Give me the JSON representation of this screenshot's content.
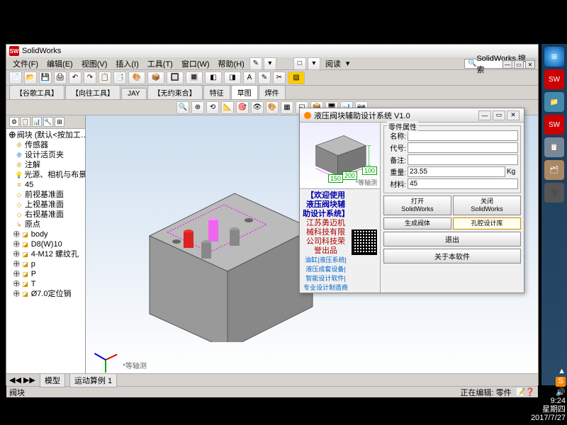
{
  "app": {
    "name": "SolidWorks"
  },
  "menus": [
    "文件(F)",
    "编辑(E)",
    "视图(V)",
    "插入(I)",
    "工具(T)",
    "窗口(W)",
    "帮助(H)"
  ],
  "search": {
    "placeholder": "SolidWorks 搜索"
  },
  "read_label": "阅读",
  "ribbon_tabs": [
    "【谷歌工具】",
    "【向往工具】",
    "JAY",
    "【无约束合】",
    "特征",
    "草图",
    "焊件"
  ],
  "active_tab": "草图",
  "tree": {
    "root": "阀块  (默认<按加工…",
    "items": [
      "传感器",
      "设计活页夹",
      "注解",
      "光源、相机与布景",
      "45",
      "前视基准面",
      "上视基准面",
      "右视基准面",
      "原点",
      "body",
      "D8(W)10",
      "4-M12 螺纹孔",
      "p",
      "P",
      "T",
      "Ø7.0定位销"
    ]
  },
  "iso_label": "*等轴测",
  "bottom_tabs": [
    "模型",
    "运动算例 1"
  ],
  "status": {
    "left": "阀块",
    "right": "正在编辑: 零件"
  },
  "dialog": {
    "title": "液压阀块辅助设计系统 V1.0",
    "props_legend": "零件属性",
    "labels": {
      "name": "名称:",
      "code": "代号:",
      "note": "备注:",
      "weight": "重量:",
      "material": "材料:",
      "kg": "Kg"
    },
    "values": {
      "name": "",
      "code": "",
      "note": "",
      "weight": "23.55",
      "material": "45"
    },
    "dims": {
      "w": "150",
      "d": "200",
      "h": "100"
    },
    "info1": "【欢迎使用液压阀块辅助设计系统】",
    "info2": "江苏勇迈机械科技有限公司科技荣誉出品",
    "info3": "油缸|液压系统|液压成套设备|智能设计软件|专业设计制造商",
    "iso": "*等轴测",
    "buttons": {
      "open": "打开\nSolidWorks",
      "close": "关闭\nSolidWorks",
      "gen": "生成阀体",
      "lib": "孔腔设计库",
      "exit": "退出",
      "about": "关于本软件"
    }
  },
  "clock": {
    "time": "9:24",
    "day": "星期四",
    "date": "2017/7/27"
  }
}
